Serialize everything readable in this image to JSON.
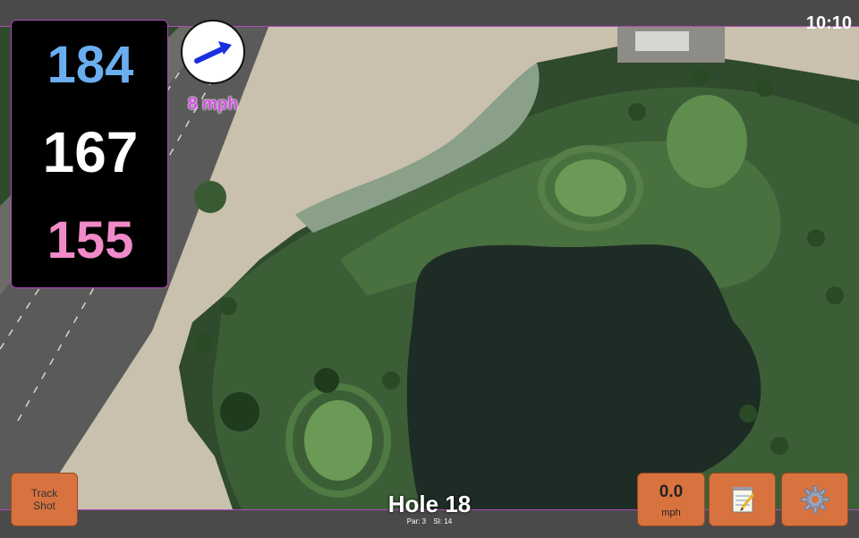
{
  "status": {
    "time": "10:10"
  },
  "distances": {
    "back": "184",
    "center": "167",
    "front": "155"
  },
  "wind": {
    "label": "8 mph",
    "arrow_icon": "arrow-right-icon"
  },
  "hole": {
    "title": "Hole 18",
    "par_label": "Par: 3",
    "si_label": "SI: 14"
  },
  "buttons": {
    "track_shot": {
      "line1": "Track",
      "line2": "Shot"
    },
    "speed": {
      "value": "0.0",
      "unit": "mph"
    },
    "notes_icon": "notepad-icon",
    "settings_icon": "gear-icon"
  },
  "colors": {
    "accent": "#b04ab8",
    "back_distance": "#6aaef0",
    "center_distance": "#ffffff",
    "front_distance": "#f08ac8",
    "button": "#d8733f",
    "wind_text": "#d24ee0"
  }
}
